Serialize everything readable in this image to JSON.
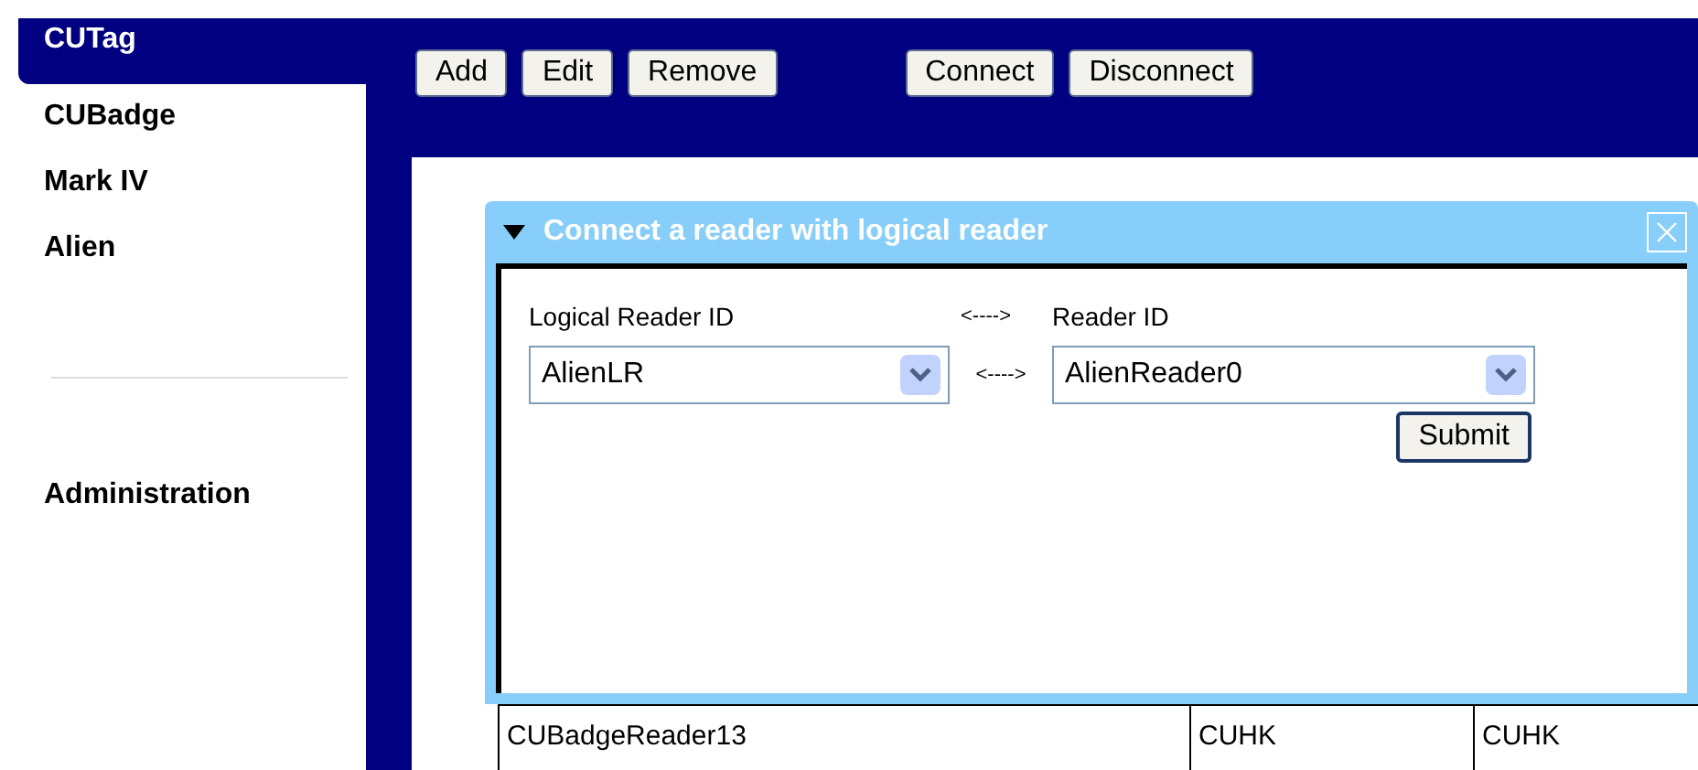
{
  "sidebar": {
    "items": [
      {
        "label": "CUTag",
        "selected": true
      },
      {
        "label": "CUBadge",
        "selected": false
      },
      {
        "label": "Mark IV",
        "selected": false
      },
      {
        "label": "Alien",
        "selected": false
      }
    ],
    "admin_items": [
      {
        "label": "Administration",
        "selected": false
      }
    ]
  },
  "toolbar": {
    "buttons": [
      "Add",
      "Edit",
      "Remove"
    ],
    "connection_buttons": [
      "Connect",
      "Disconnect"
    ]
  },
  "dialog": {
    "title": "Connect a reader with logical reader",
    "expanded": true,
    "logical_reader_label": "Logical Reader ID",
    "arrow_label": "<---->",
    "reader_label": "Reader ID",
    "logical_reader_value": "AlienLR",
    "arrow_between": "<---->",
    "reader_value": "AlienReader0",
    "submit": "Submit"
  },
  "table": {
    "rows": [
      [
        "CUBadgeReader13",
        "CUHK",
        "CUHK"
      ]
    ]
  }
}
